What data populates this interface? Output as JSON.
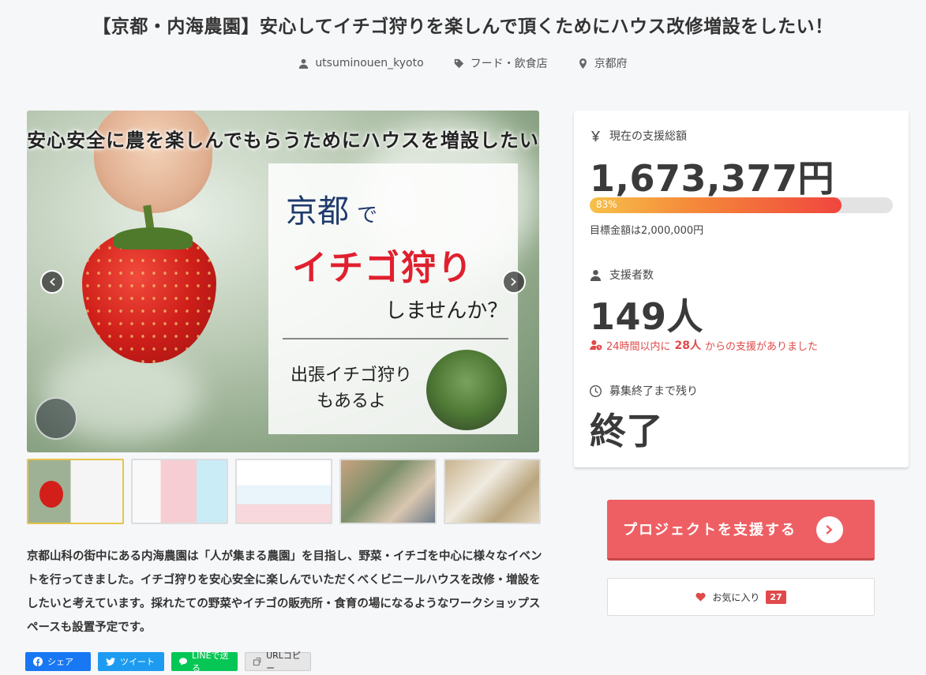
{
  "page": {
    "title": "【京都・内海農園】安心してイチゴ狩りを楽しんで頂くためにハウス改修増設をしたい！"
  },
  "meta": {
    "owner": "utsuminouen_kyoto",
    "category": "フード・飲食店",
    "location": "京都府"
  },
  "hero": {
    "headline": "安心安全に農を楽しんでもらうためにハウスを増設したい",
    "card_kyoto": "京都",
    "card_de": "で",
    "card_ichigo": "イチゴ狩り",
    "card_shimasen": "しませんか？",
    "card_shucho": "出張イチゴ狩り\nもあるよ",
    "prev_icon": "chevron-left-icon",
    "next_icon": "chevron-right-icon"
  },
  "description": "京都山科の街中にある内海農園は「人が集まる農園」を目指し、野菜・イチゴを中心に様々なイベントを行ってきました。イチゴ狩りを安心安全に楽しんでいただくべくビニールハウスを改修・増設をしたいと考えています。採れたての野菜やイチゴの販売所・食育の場になるようなワークショップスペースも設置予定です。",
  "share": {
    "facebook": "シェア",
    "twitter": "ツイート",
    "line": "LINEで送る",
    "url_copy": "URLコピー"
  },
  "stats": {
    "total_label": "現在の支援総額",
    "total_value": "1,673,377円",
    "progress_percent": 83,
    "progress_text": "83%",
    "goal_text": "目標金額は2,000,000円",
    "supporters_label": "支援者数",
    "supporters_value": "149人",
    "recent_prefix": "24時間以内に",
    "recent_count": "28人",
    "recent_suffix": "からの支援がありました",
    "remaining_label": "募集終了まで残り",
    "remaining_value": "終了"
  },
  "actions": {
    "support_label": "プロジェクトを支援する",
    "favorite_label": "お気に入り",
    "favorite_count": "27"
  },
  "colors": {
    "accent": "#ee5f63",
    "recent_red": "#e04a4a",
    "progress_start": "#f6c14a",
    "progress_end": "#f0463e"
  }
}
